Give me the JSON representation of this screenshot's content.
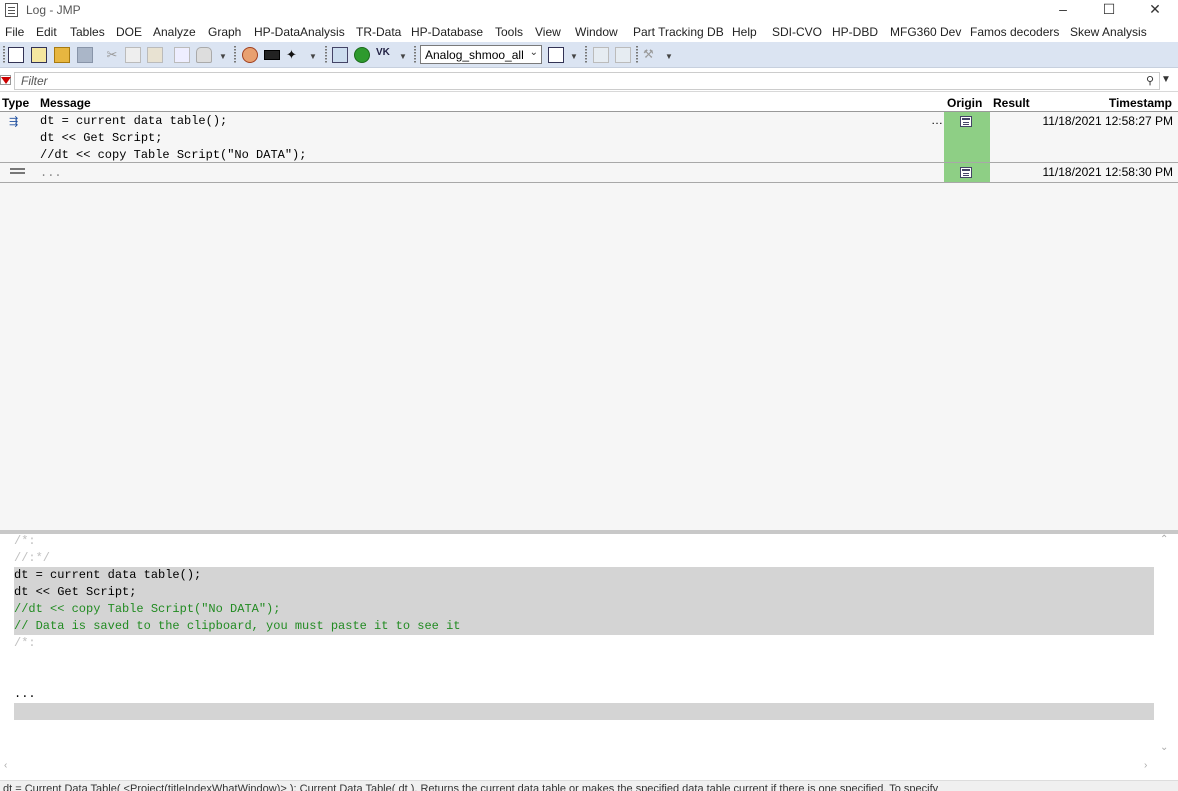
{
  "window": {
    "title": "Log - JMP"
  },
  "menu": [
    "File",
    "Edit",
    "Tables",
    "DOE",
    "Analyze",
    "Graph",
    "HP-DataAnalysis",
    "TR-Data",
    "HP-Database",
    "Tools",
    "View",
    "Window",
    "Part Tracking DB",
    "Help",
    "SDI-CVO",
    "HP-DBD",
    "MFG360 Dev",
    "Famos decoders",
    "Skew Analysis"
  ],
  "toolbar": {
    "combo_value": "Analog_shmoo_all"
  },
  "filter": {
    "placeholder": "Filter"
  },
  "log": {
    "columns": {
      "type": "Type",
      "message": "Message",
      "origin": "Origin",
      "result": "Result",
      "timestamp": "Timestamp"
    },
    "rows": [
      {
        "lines": [
          "dt = current data table();",
          "dt << Get Script;",
          "//dt << copy Table Script(\"No DATA\");"
        ],
        "more": "…",
        "timestamp": "11/18/2021 12:58:27 PM"
      },
      {
        "lines": [
          "..."
        ],
        "timestamp": "11/18/2021 12:58:30 PM"
      }
    ]
  },
  "editor": {
    "lines": [
      "/*:",
      "//:*/",
      "dt = current data table();",
      "dt << Get Script;",
      "//dt << copy Table Script(\"No DATA\");",
      "// Data is saved to the clipboard, you must paste it to see it",
      "/*:",
      "",
      "",
      "..."
    ]
  },
  "status": {
    "text": "dt = Current Data Table( <Project(titleIndexWhatWindow)> ); Current Data Table( dt ). Returns the current data table or makes the specified data table current if there is one specified.   To specify"
  },
  "colors": {
    "toolbar": "#dbe4f2",
    "origin": "#8ecf85",
    "comment": "#228b22",
    "faded": "#c0c0c0",
    "highlight": "#d4d4d4"
  }
}
